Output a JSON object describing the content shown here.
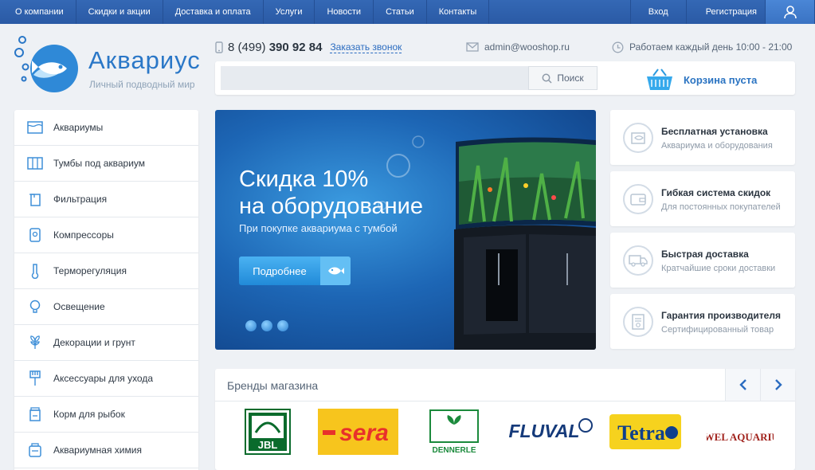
{
  "nav": {
    "items": [
      "О компании",
      "Скидки и акции",
      "Доставка и оплата",
      "Услуги",
      "Новости",
      "Статьи",
      "Контакты"
    ],
    "login": "Вход",
    "register": "Регистрация",
    "user_icon": "user-icon"
  },
  "logo": {
    "name": "Аквариус",
    "tagline": "Личный подводный мир"
  },
  "contacts": {
    "phone_prefix": "8 (499)",
    "phone_main": "390 92 84",
    "callback": "Заказать звонок",
    "email": "admin@wooshop.ru",
    "hours": "Работаем каждый день 10:00 - 21:00"
  },
  "search": {
    "placeholder": "",
    "button": "Поиск"
  },
  "cart": {
    "label": "Корзина пуста"
  },
  "sidebar": {
    "items": [
      {
        "label": "Аквариумы",
        "icon": "aquarium-icon"
      },
      {
        "label": "Тумбы под аквариум",
        "icon": "cabinet-icon"
      },
      {
        "label": "Фильтрация",
        "icon": "filter-icon"
      },
      {
        "label": "Компрессоры",
        "icon": "compressor-icon"
      },
      {
        "label": "Терморегуляция",
        "icon": "thermometer-icon"
      },
      {
        "label": "Освещение",
        "icon": "lightbulb-icon"
      },
      {
        "label": "Декорации и грунт",
        "icon": "plant-icon"
      },
      {
        "label": "Аксессуары для ухода",
        "icon": "brush-icon"
      },
      {
        "label": "Корм для рыбок",
        "icon": "food-icon"
      },
      {
        "label": "Аквариумная химия",
        "icon": "chemistry-icon"
      }
    ]
  },
  "banner": {
    "title_line1": "Скидка 10%",
    "title_line2": "на оборудование",
    "subtitle": "При покупке аквариума с тумбой",
    "button": "Подробнее"
  },
  "features": [
    {
      "title": "Бесплатная установка",
      "subtitle": "Аквариума и оборудования",
      "icon": "aquarium-icon"
    },
    {
      "title": "Гибкая система скидок",
      "subtitle": "Для постоянных покупателей",
      "icon": "wallet-icon"
    },
    {
      "title": "Быстрая доставка",
      "subtitle": "Кратчайшие сроки доставки",
      "icon": "truck-icon"
    },
    {
      "title": "Гарантия производителя",
      "subtitle": "Сертифицированный товар",
      "icon": "certificate-icon"
    }
  ],
  "brands": {
    "title": "Бренды магазина",
    "items": [
      "JBL",
      "sera",
      "DENNERLE",
      "FLUVAL",
      "Tetra",
      "JUWEL AQUARIUM"
    ]
  },
  "colors": {
    "nav_bg": "#2e60ad",
    "accent": "#2b74c2",
    "page_bg": "#eef1f5"
  }
}
